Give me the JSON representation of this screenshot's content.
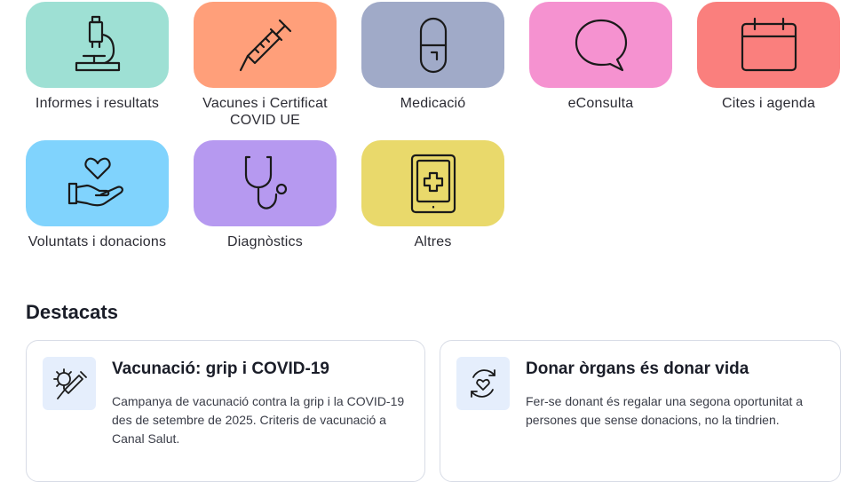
{
  "tiles": [
    {
      "label": "Informes i resultats",
      "icon": "microscope-icon",
      "color": "#9ee0d4"
    },
    {
      "label": "Vacunes i Certificat COVID UE",
      "icon": "syringe-icon",
      "color": "#ff9f7a"
    },
    {
      "label": "Medicació",
      "icon": "pill-icon",
      "color": "#a0aac8"
    },
    {
      "label": "eConsulta",
      "icon": "chat-bubble-icon",
      "color": "#f592d0"
    },
    {
      "label": "Cites i agenda",
      "icon": "calendar-icon",
      "color": "#fa7f7d"
    },
    {
      "label": "Voluntats i donacions",
      "icon": "heart-hand-icon",
      "color": "#80d3fd"
    },
    {
      "label": "Diagnòstics",
      "icon": "stethoscope-icon",
      "color": "#b699f0"
    },
    {
      "label": "Altres",
      "icon": "tablet-cross-icon",
      "color": "#e9d96b"
    }
  ],
  "highlights": {
    "title": "Destacats",
    "cards": [
      {
        "title": "Vacunació: grip i COVID-19",
        "description": "Campanya de vacunació contra la grip i la COVID-19 des de setembre de 2025. Criteris de vacunació a Canal Salut.",
        "icon": "virus-syringe-icon"
      },
      {
        "title": "Donar òrgans és donar vida",
        "description": "Fer-se donant és regalar una segona oportunitat a persones que sense donacions, no la tindrien.",
        "icon": "heart-cycle-icon"
      }
    ]
  }
}
